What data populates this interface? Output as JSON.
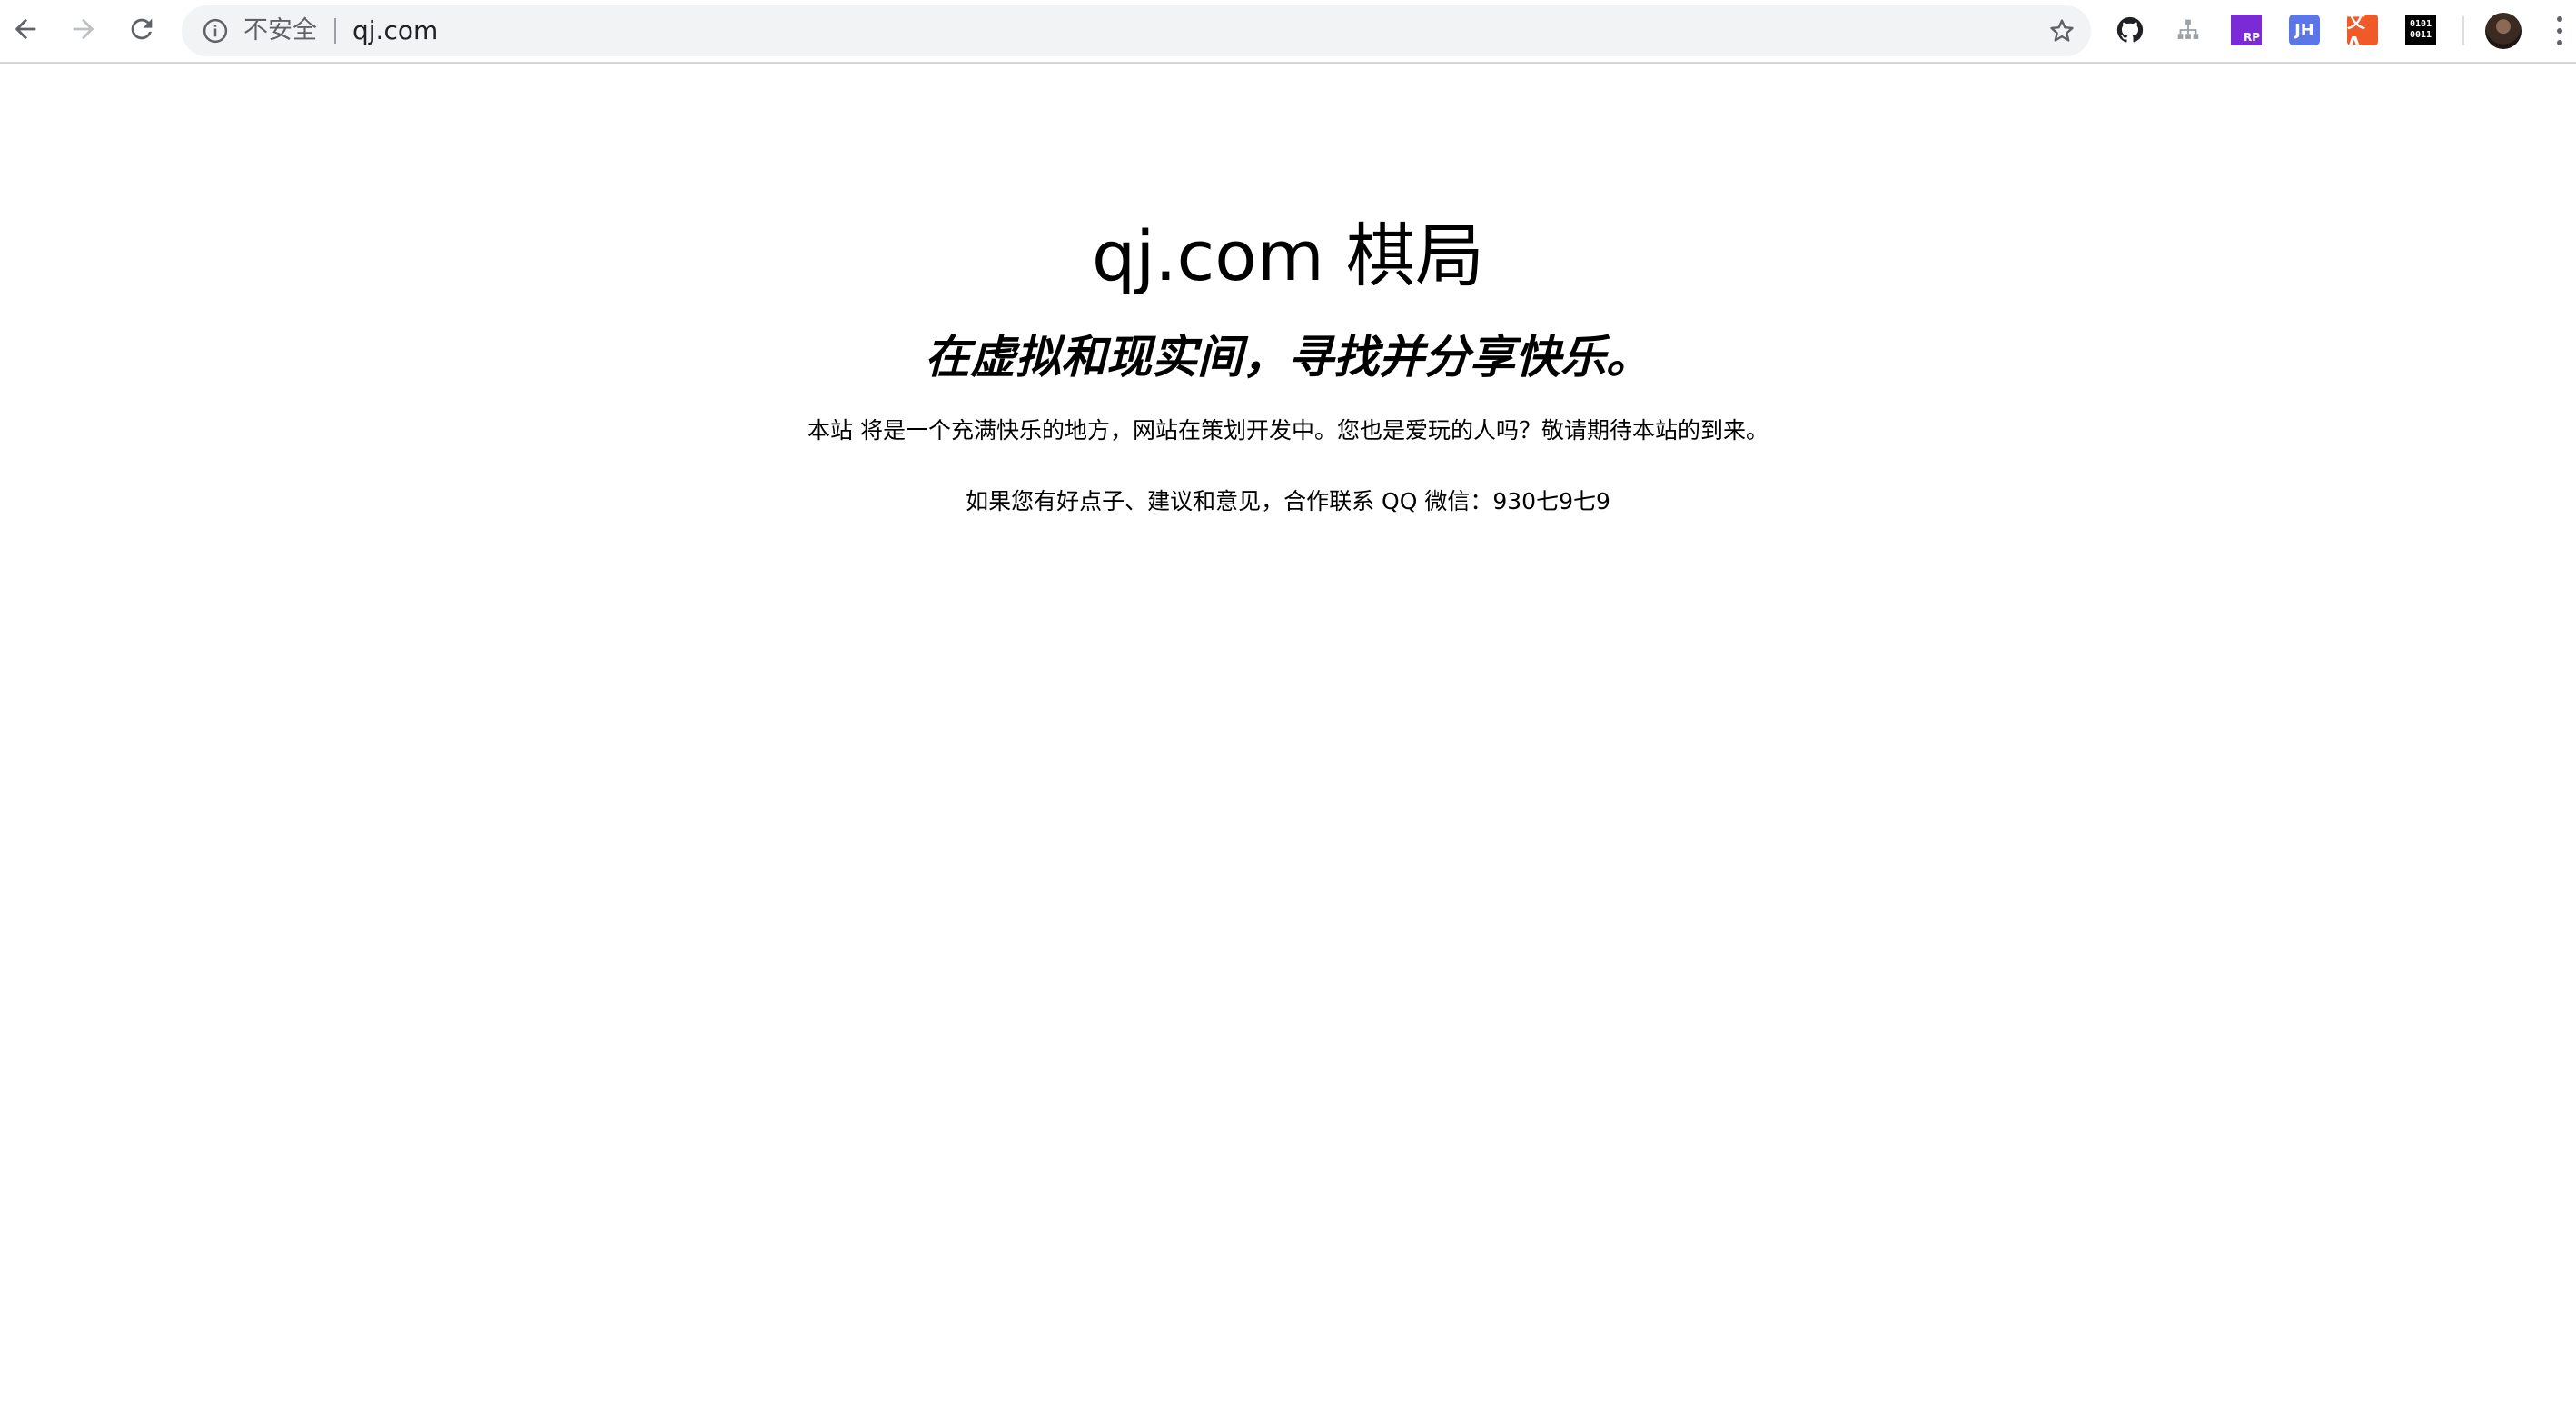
{
  "browser": {
    "security_label": "不安全",
    "url": "qj.com",
    "icons": {
      "back": "back-arrow-icon",
      "forward": "forward-arrow-icon",
      "reload": "reload-icon",
      "info": "info-icon",
      "star": "bookmark-star-icon",
      "menu": "kebab-menu-icon"
    },
    "extensions": [
      {
        "name": "github-extension-icon",
        "label": ""
      },
      {
        "name": "sitemap-extension-icon",
        "label": ""
      },
      {
        "name": "rp-extension-icon",
        "label": "RP"
      },
      {
        "name": "jh-extension-icon",
        "label": "JH"
      },
      {
        "name": "translate-extension-icon",
        "label": "文A"
      },
      {
        "name": "binary-extension-icon",
        "label": "0101 0011"
      }
    ]
  },
  "page": {
    "title": "qj.com 棋局",
    "tagline": "在虚拟和现实间，寻找并分享快乐。",
    "description": "本站 将是一个充满快乐的地方，网站在策划开发中。您也是爱玩的人吗？敬请期待本站的到来。",
    "contact": "如果您有好点子、建议和意见，合作联系 QQ 微信：930七9七9"
  },
  "colors": {
    "omnibox_bg": "#f1f3f4",
    "rp_ext": "#7b2bd6",
    "jh_ext": "#5b76e6",
    "translate_ext": "#ef5a28",
    "binary_ext": "#000000"
  }
}
